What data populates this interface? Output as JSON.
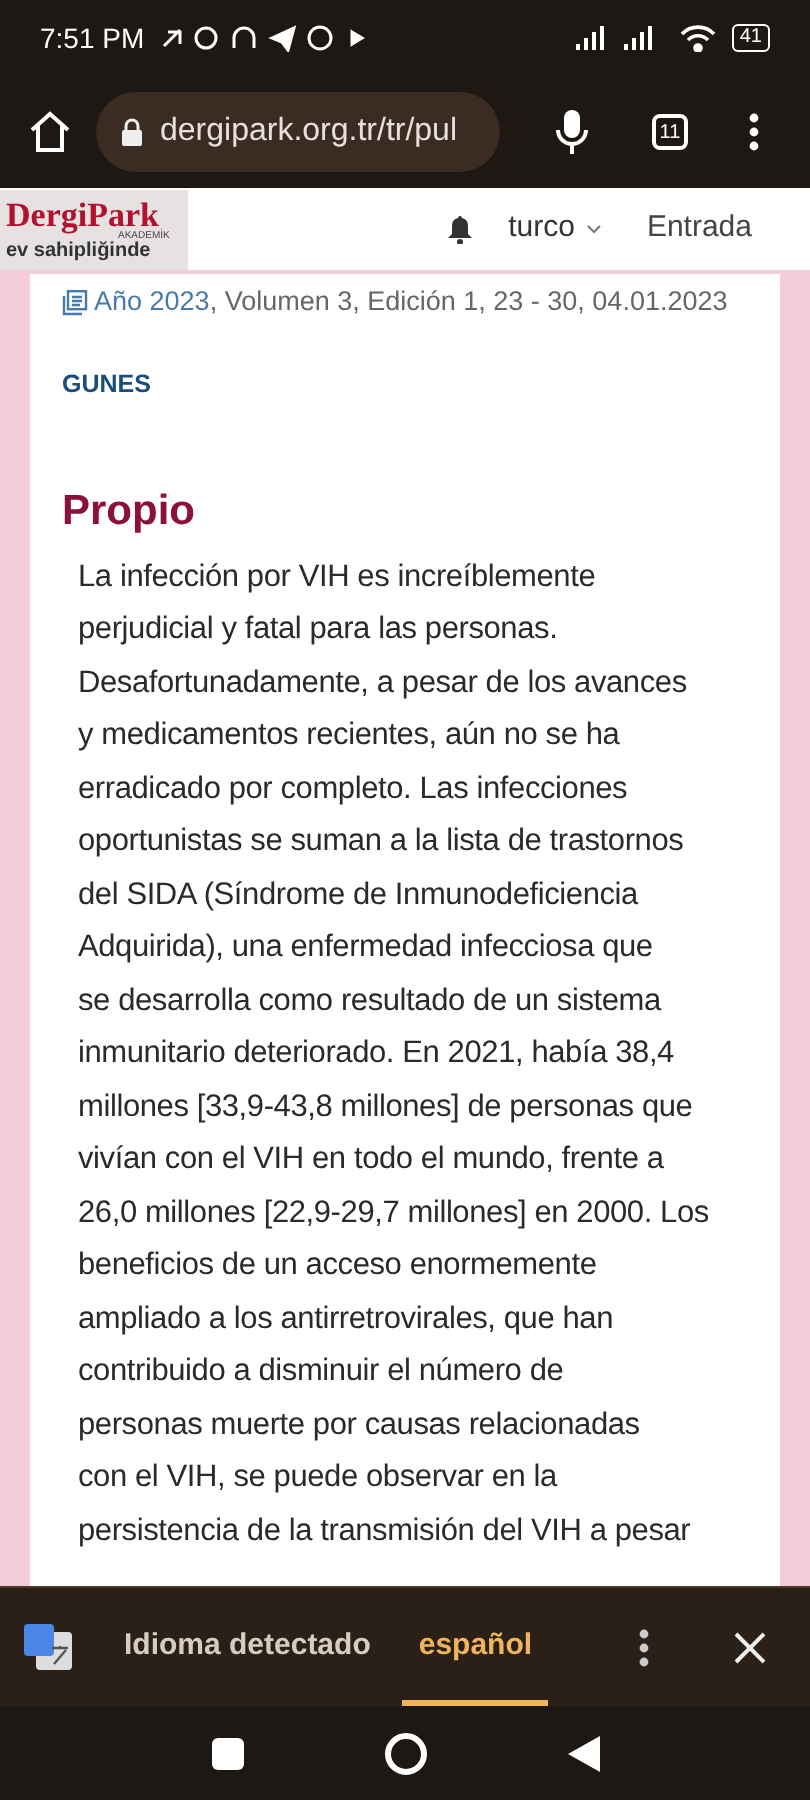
{
  "status_bar": {
    "time": "7:51 PM",
    "battery": "41"
  },
  "browser": {
    "url": "dergipark.org.tr/tr/pul",
    "tab_count": "11"
  },
  "site_header": {
    "logo": "DergiPark",
    "logo_sub": "AKADEMİK",
    "logo_tag": "ev sahipliğinde",
    "language": "turco",
    "login": "Entrada"
  },
  "article": {
    "year_link": "Año 2023",
    "citation": ", Volumen 3, Edición 1, 23 - 30, 04.01.2023",
    "author": "GUNES",
    "heading": "Propio",
    "body": "La infección por VIH es increíblemente\nperjudicial y fatal para las personas.\nDesafortunadamente, a pesar de los avances\ny medicamentos recientes, aún no se ha\nerradicado por completo. Las infecciones\noportunistas se suman a la lista de trastornos\ndel SIDA (Síndrome de Inmunodeficiencia\nAdquirida), una enfermedad infecciosa que\nse desarrolla como resultado de un sistema\ninmunitario deteriorado. En 2021, había 38,4\nmillones [33,9-43,8 millones] de personas que\nvivían con el VIH en todo el mundo, frente a\n26,0 millones [22,9-29,7 millones] en 2000. Los\nbeneficios de un acceso enormemente\nampliado a los antirretrovirales, que han\ncontribuido a disminuir el número de\npersonas muerte por causas relacionadas\ncon el VIH, se puede observar en la\npersistencia de la transmisión del VIH a pesar"
  },
  "translate_bar": {
    "tabs": [
      {
        "label": "Idioma detectado",
        "selected": false
      },
      {
        "label": "español",
        "selected": true
      }
    ]
  }
}
